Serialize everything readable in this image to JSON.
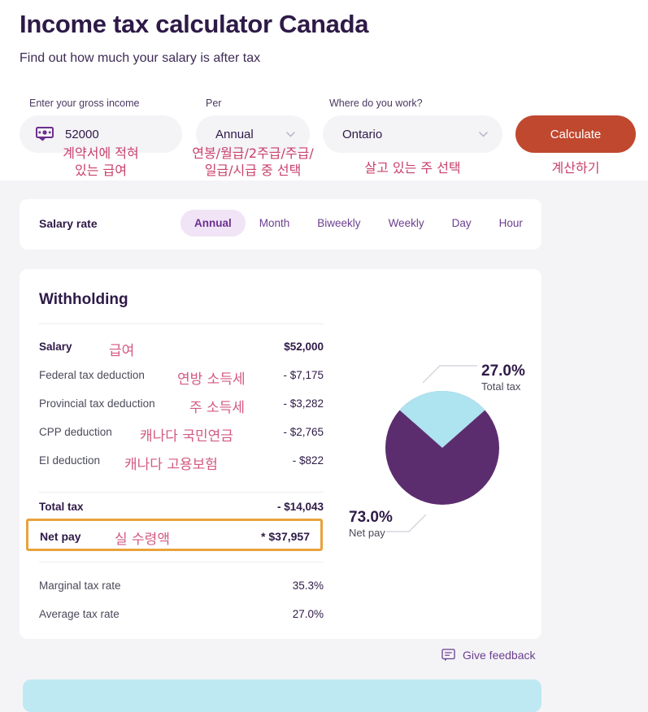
{
  "header": {
    "title": "Income tax calculator Canada",
    "subtitle": "Find out how much your salary is after tax"
  },
  "form": {
    "income_label": "Enter your gross income",
    "income_value": "52000",
    "income_icon": "money-bill-icon",
    "per_label": "Per",
    "per_value": "Annual",
    "where_label": "Where do you work?",
    "where_value": "Ontario",
    "calculate_label": "Calculate",
    "annotations": {
      "income": "계약서에 적혀\n있는 급여",
      "income_line1": "계약서에 적혀",
      "income_line2": "있는 급여",
      "per_line1": "연봉/월급/2주급/주급/",
      "per_line2": "일급/시급 중 선택",
      "where": "살고 있는 주 선택",
      "calculate": "계산하기"
    }
  },
  "salary_rate": {
    "label": "Salary rate",
    "tabs": [
      {
        "label": "Annual",
        "active": true
      },
      {
        "label": "Month",
        "active": false
      },
      {
        "label": "Biweekly",
        "active": false
      },
      {
        "label": "Weekly",
        "active": false
      },
      {
        "label": "Day",
        "active": false
      },
      {
        "label": "Hour",
        "active": false
      }
    ]
  },
  "withholding": {
    "title": "Withholding",
    "rows": [
      {
        "label": "Salary",
        "kr": "급여",
        "value": "$52,000",
        "bold": true
      },
      {
        "label": "Federal tax deduction",
        "kr": "연방 소득세",
        "value": "- $7,175",
        "bold": false
      },
      {
        "label": "Provincial tax deduction",
        "kr": "주 소득세",
        "value": "- $3,282",
        "bold": false
      },
      {
        "label": "CPP deduction",
        "kr": "캐나다 국민연금",
        "value": "- $2,765",
        "bold": false
      },
      {
        "label": "EI deduction",
        "kr": "캐나다 고용보험",
        "value": "- $822",
        "bold": false
      }
    ],
    "total_tax": {
      "label": "Total tax",
      "value": "- $14,043"
    },
    "net_pay": {
      "label": "Net pay",
      "kr": "실 수령액",
      "value": "* $37,957"
    },
    "rates": [
      {
        "label": "Marginal tax rate",
        "value": "35.3%"
      },
      {
        "label": "Average tax rate",
        "value": "27.0%"
      }
    ]
  },
  "chart_data": {
    "type": "pie",
    "title": "",
    "legend_position": "callout",
    "slices": [
      {
        "name": "Total tax",
        "label": "27.0%",
        "value": 27.0,
        "color": "#aee3f0"
      },
      {
        "name": "Net pay",
        "label": "73.0%",
        "value": 73.0,
        "color": "#5c2d6e"
      }
    ],
    "start_angle_deg": -48.6,
    "total": 100
  },
  "footer": {
    "feedback_label": "Give feedback",
    "feedback_icon": "comment-icon"
  },
  "colors": {
    "accent_purple": "#5c2d6e",
    "accent_light_blue": "#aee3f0",
    "calculate_button": "#c0482f",
    "annotation_pink": "#c9406b",
    "highlight_border": "#e8a23c",
    "page_background": "#f4f4f7"
  }
}
